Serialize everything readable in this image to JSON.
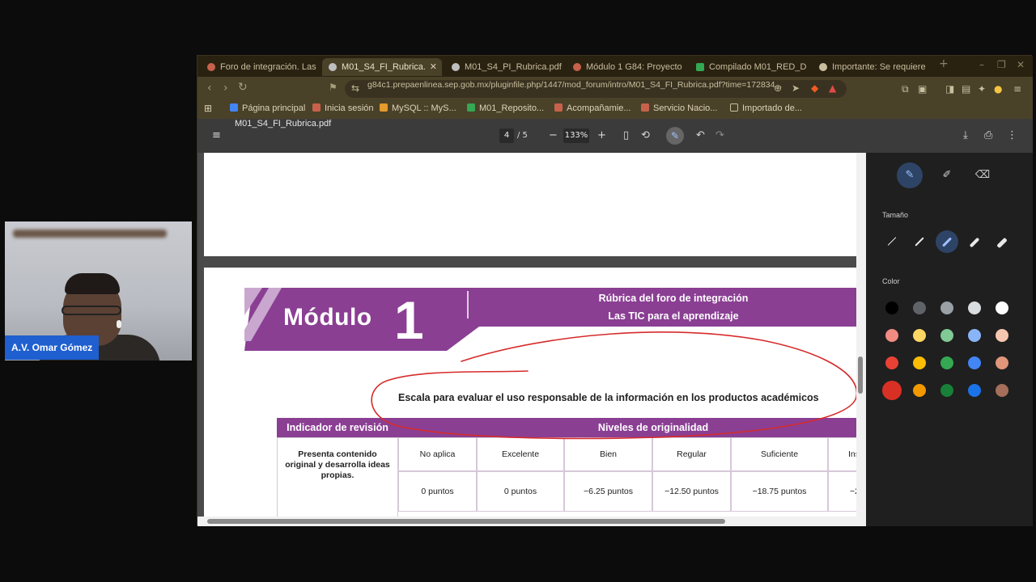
{
  "webcam": {
    "participant_name": "A.V. Omar Gómez"
  },
  "browser": {
    "tabs": [
      {
        "label": "Foro de integración. Las",
        "icon_color": "#c8614b"
      },
      {
        "label": "M01_S4_FI_Rubrica.",
        "icon_color": "#bfbfbf",
        "active": true
      },
      {
        "label": "M01_S4_PI_Rubrica.pdf",
        "icon_color": "#bfbfbf"
      },
      {
        "label": "Módulo 1 G84: Proyecto",
        "icon_color": "#c8614b"
      },
      {
        "label": "Compilado M01_RED_D",
        "icon_color": "#34a853"
      },
      {
        "label": "Importante: Se requiere",
        "icon_color": "#c9bf9f"
      }
    ],
    "new_tab_label": "+",
    "url": "g84c1.prepaenlinea.sep.gob.mx/pluginfile.php/1447/mod_forum/intro/M01_S4_FI_Rubrica.pdf?time=172834...",
    "bookmarks": [
      {
        "label": "Página principal",
        "icon_color": "#4285f4"
      },
      {
        "label": "Inicia sesión",
        "icon_color": "#c8614b"
      },
      {
        "label": "MySQL :: MyS...",
        "icon_color": "#e59a2a"
      },
      {
        "label": "M01_Reposito...",
        "icon_color": "#34a853"
      },
      {
        "label": "Acompañamie...",
        "icon_color": "#c8614b"
      },
      {
        "label": "Servicio Nacio...",
        "icon_color": "#c8614b"
      },
      {
        "label": "Importado de...",
        "icon_color": "#c9bf9f"
      }
    ]
  },
  "pdf_viewer": {
    "filename": "M01_S4_FI_Rubrica.pdf",
    "current_page": "4",
    "total_pages": "/ 5",
    "zoom": "133%",
    "minus": "−",
    "plus": "+"
  },
  "document": {
    "module_word": "Módulo",
    "module_number": "1",
    "rubric_title": "Rúbrica del foro de integración",
    "rubric_subtitle": "Las TIC para el aprendizaje",
    "scale_heading": "Escala para evaluar el uso responsable de la información en los productos académicos",
    "brand_color": "#8a3f93",
    "annotation_color": "#d62b2b",
    "table": {
      "header_left": "Indicador de revisión",
      "header_right": "Niveles de originalidad",
      "indicator": "Presenta contenido original y desarrolla ideas propias.",
      "levels": [
        "No aplica",
        "Excelente",
        "Bien",
        "Regular",
        "Suficiente",
        "Ins"
      ],
      "points": [
        "0 puntos",
        "0 puntos",
        "−6.25 puntos",
        "−12.50 puntos",
        "−18.75 puntos",
        "−2"
      ]
    }
  },
  "annotation_panel": {
    "size_label": "Tamaño",
    "color_label": "Color",
    "tools": [
      "pen-icon",
      "highlighter-icon",
      "eraser-icon"
    ],
    "colors": [
      [
        "#000000",
        "#5f6368",
        "#9aa0a6",
        "#dadce0",
        "#ffffff"
      ],
      [
        "#f28b82",
        "#fdd663",
        "#81c995",
        "#8ab4f8",
        "#f6c7b0"
      ],
      [
        "#e94235",
        "#fbbc04",
        "#34a853",
        "#4285f4",
        "#e0967a"
      ],
      [
        "#d93025",
        "#f29900",
        "#188038",
        "#1a73e8",
        "#a66f5b"
      ]
    ],
    "selected_color": "#d93025"
  }
}
